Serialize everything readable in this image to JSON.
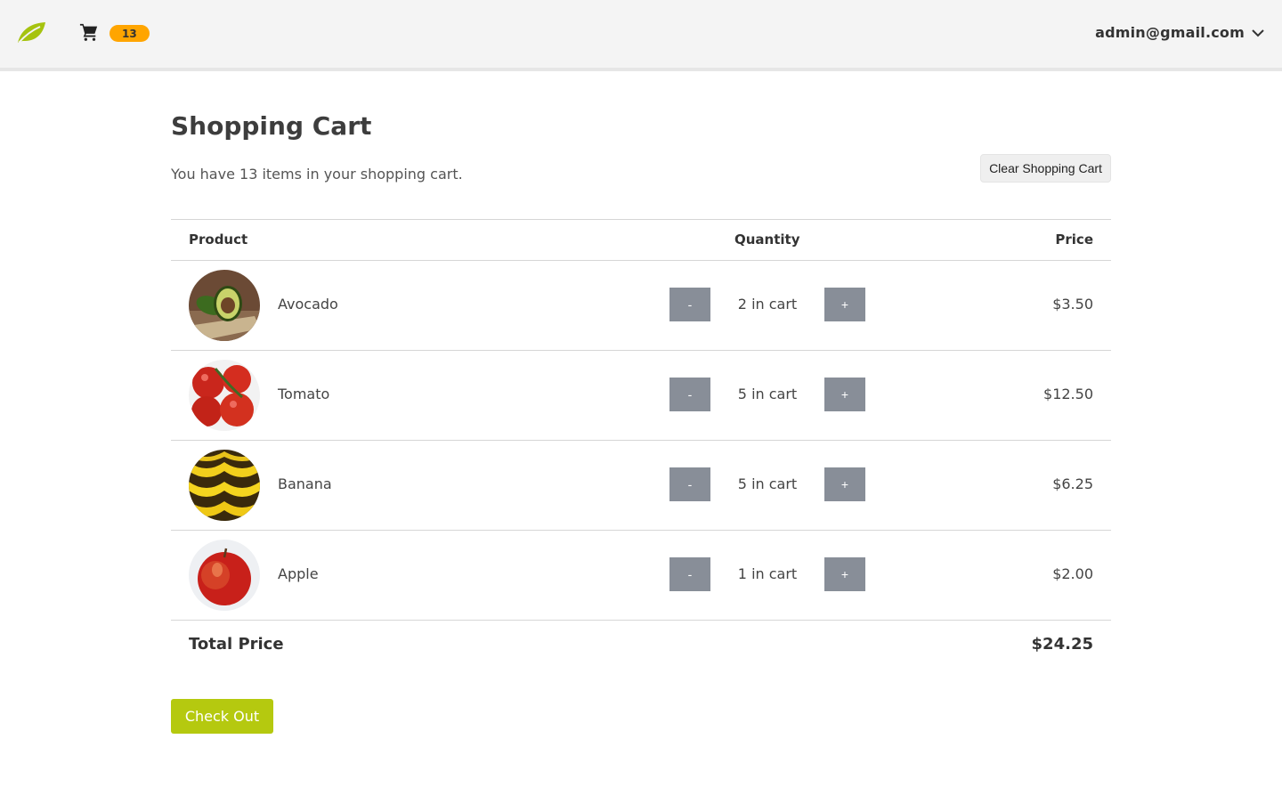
{
  "nav": {
    "logo_icon": "leaf-icon",
    "cart_icon": "cart-icon",
    "cart_count": "13",
    "user_email": "admin@gmail.com",
    "dropdown_icon": "chevron-down-icon"
  },
  "page": {
    "title": "Shopping Cart",
    "summary": "You have 13 items in your shopping cart.",
    "clear_label": "Clear Shopping Cart"
  },
  "table": {
    "headers": {
      "product": "Product",
      "quantity": "Quantity",
      "price": "Price"
    },
    "items": [
      {
        "name": "Avocado",
        "image_icon": "avocado-image",
        "minus": "-",
        "quantity": "2 in cart",
        "plus": "+",
        "price": "$3.50"
      },
      {
        "name": "Tomato",
        "image_icon": "tomato-image",
        "minus": "-",
        "quantity": "5 in cart",
        "plus": "+",
        "price": "$12.50"
      },
      {
        "name": "Banana",
        "image_icon": "banana-image",
        "minus": "-",
        "quantity": "5 in cart",
        "plus": "+",
        "price": "$6.25"
      },
      {
        "name": "Apple",
        "image_icon": "apple-image",
        "minus": "-",
        "quantity": "1 in cart",
        "plus": "+",
        "price": "$2.00"
      }
    ],
    "total_label": "Total Price",
    "total_value": "$24.25"
  },
  "checkout_label": "Check Out",
  "colors": {
    "accent": "#b5c90f",
    "badge": "#ffa500",
    "qty_button": "#888e98",
    "nav_bg": "#f4f4f4"
  }
}
